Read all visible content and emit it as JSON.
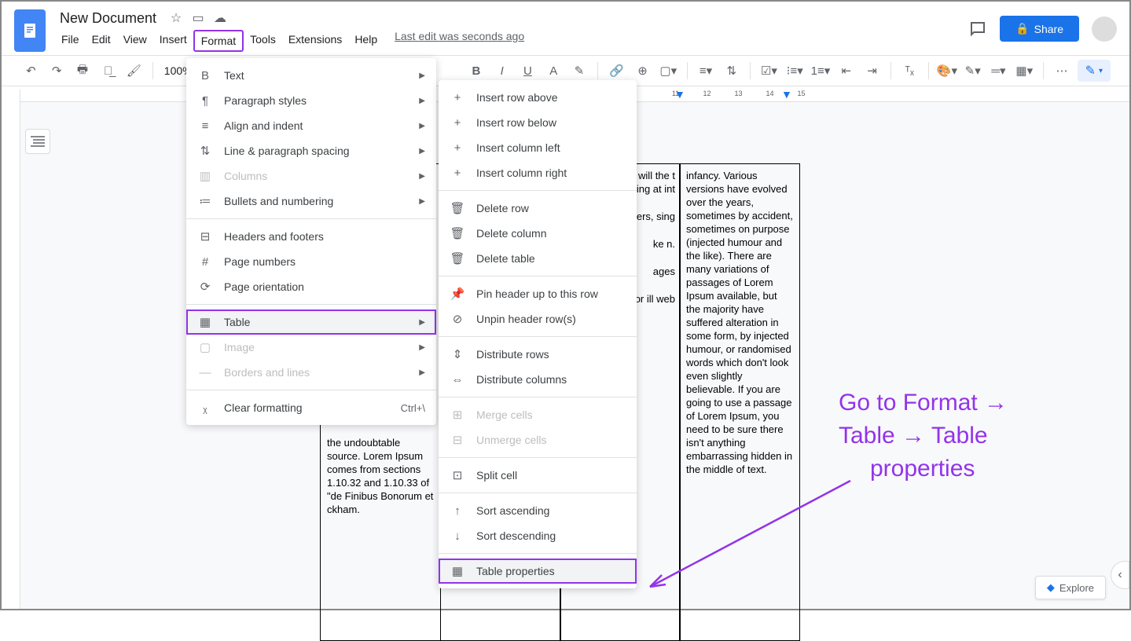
{
  "header": {
    "title": "New Document",
    "last_edit": "Last edit was seconds ago",
    "share": "Share"
  },
  "menubar": [
    "File",
    "Edit",
    "View",
    "Insert",
    "Format",
    "Tools",
    "Extensions",
    "Help"
  ],
  "toolbar": {
    "zoom": "100%"
  },
  "ruler": [
    "11",
    "12",
    "13",
    "14",
    "15"
  ],
  "format_menu": [
    {
      "icon": "B",
      "label": "Text",
      "arrow": true
    },
    {
      "icon": "¶",
      "label": "Paragraph styles",
      "arrow": true
    },
    {
      "icon": "≡",
      "label": "Align and indent",
      "arrow": true
    },
    {
      "icon": "⇅",
      "label": "Line & paragraph spacing",
      "arrow": true
    },
    {
      "icon": "▥",
      "label": "Columns",
      "arrow": true,
      "disabled": true
    },
    {
      "icon": "≔",
      "label": "Bullets and numbering",
      "arrow": true
    },
    {
      "sep": true
    },
    {
      "icon": "⊟",
      "label": "Headers and footers"
    },
    {
      "icon": "#",
      "label": "Page numbers"
    },
    {
      "icon": "⟳",
      "label": "Page orientation"
    },
    {
      "sep": true
    },
    {
      "icon": "▦",
      "label": "Table",
      "arrow": true,
      "highlighted": true,
      "hover": true
    },
    {
      "icon": "▢",
      "label": "Image",
      "arrow": true,
      "disabled": true
    },
    {
      "icon": "—",
      "label": "Borders and lines",
      "arrow": true,
      "disabled": true
    },
    {
      "sep": true
    },
    {
      "icon": "ᵪ",
      "label": "Clear formatting",
      "shortcut": "Ctrl+\\"
    }
  ],
  "table_submenu": [
    {
      "icon": "+",
      "label": "Insert row above"
    },
    {
      "icon": "+",
      "label": "Insert row below"
    },
    {
      "icon": "+",
      "label": "Insert column left"
    },
    {
      "icon": "+",
      "label": "Insert column right"
    },
    {
      "sep": true
    },
    {
      "icon": "🗑",
      "label": "Delete row"
    },
    {
      "icon": "🗑",
      "label": "Delete column"
    },
    {
      "icon": "🗑",
      "label": "Delete table"
    },
    {
      "sep": true
    },
    {
      "icon": "📌",
      "label": "Pin header up to this row"
    },
    {
      "icon": "⊘",
      "label": "Unpin header row(s)"
    },
    {
      "sep": true
    },
    {
      "icon": "⇕",
      "label": "Distribute rows"
    },
    {
      "icon": "⇔",
      "label": "Distribute columns"
    },
    {
      "sep": true
    },
    {
      "icon": "⊞",
      "label": "Merge cells",
      "disabled": true
    },
    {
      "icon": "⊟",
      "label": "Unmerge cells",
      "disabled": true
    },
    {
      "sep": true
    },
    {
      "icon": "⊡",
      "label": "Split cell"
    },
    {
      "sep": true
    },
    {
      "icon": "↑",
      "label": "Sort ascending"
    },
    {
      "icon": "↓",
      "label": "Sort descending"
    },
    {
      "sep": true
    },
    {
      "icon": "▦",
      "label": "Table properties",
      "highlighted": true,
      "hover": true
    }
  ],
  "doc_cells": {
    "c1": "the undoubtable source. Lorem Ipsum comes from sections 1.10.32 and 1.10.33 of \"de Finibus Bonorum et ckham.",
    "c3a": "tion . It is ed er will the t of a ing at int",
    "c3b": "as a rmal ters, sing",
    "c3c": "ke n.",
    "c3d": "ages",
    "c3e": "s del ch for ill web",
    "c4": "infancy. Various versions have evolved over the years, sometimes by accident, sometimes on purpose (injected humour and the like). There are many variations of passages of Lorem Ipsum available, but the majority have suffered alteration in some form, by injected humour, or randomised words which don't look even slightly believable. If you are going to use a passage of Lorem Ipsum, you need to be sure there isn't anything embarrassing hidden in the middle of text."
  },
  "annotation": {
    "l1": "Go to Format →",
    "l2": "Table → Table",
    "l3": "properties"
  },
  "explore": "Explore"
}
